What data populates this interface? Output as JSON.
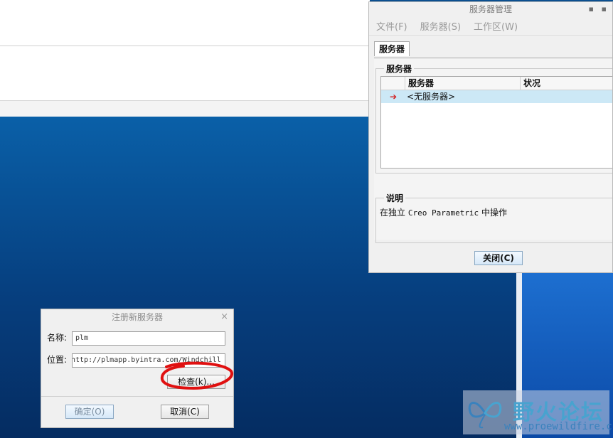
{
  "server_window": {
    "title": "服务器管理",
    "minimize_glyph": "▪",
    "menu": [
      "文件(F)",
      "服务器(S)",
      "工作区(W)"
    ],
    "tab": "服务器",
    "group_servers": "服务器",
    "columns": [
      "服务器",
      "状况"
    ],
    "rows": [
      {
        "marker": "➔",
        "name": "<无服务器>",
        "status": ""
      }
    ],
    "group_description": "说明",
    "description_prefix": "在独立",
    "description_app": "Creo Parametric",
    "description_suffix": "中操作",
    "close_button": "关闭(C)"
  },
  "register_dialog": {
    "title": "注册新服务器",
    "close_glyph": "×",
    "name_label": "名称:",
    "name_value": "plm",
    "location_label": "位置:",
    "location_value": "http://plmapp.byintra.com/Windchill",
    "check_button": "检查(k)...",
    "ok_button": "确定(O)",
    "cancel_button": "取消(C)"
  },
  "watermark": {
    "text": "野火论坛",
    "url": "www.proewildfire.cn"
  },
  "colors": {
    "annotation_circle": "#e01010",
    "selected_row": "#cce8f6",
    "desktop": "#0a60a8"
  }
}
